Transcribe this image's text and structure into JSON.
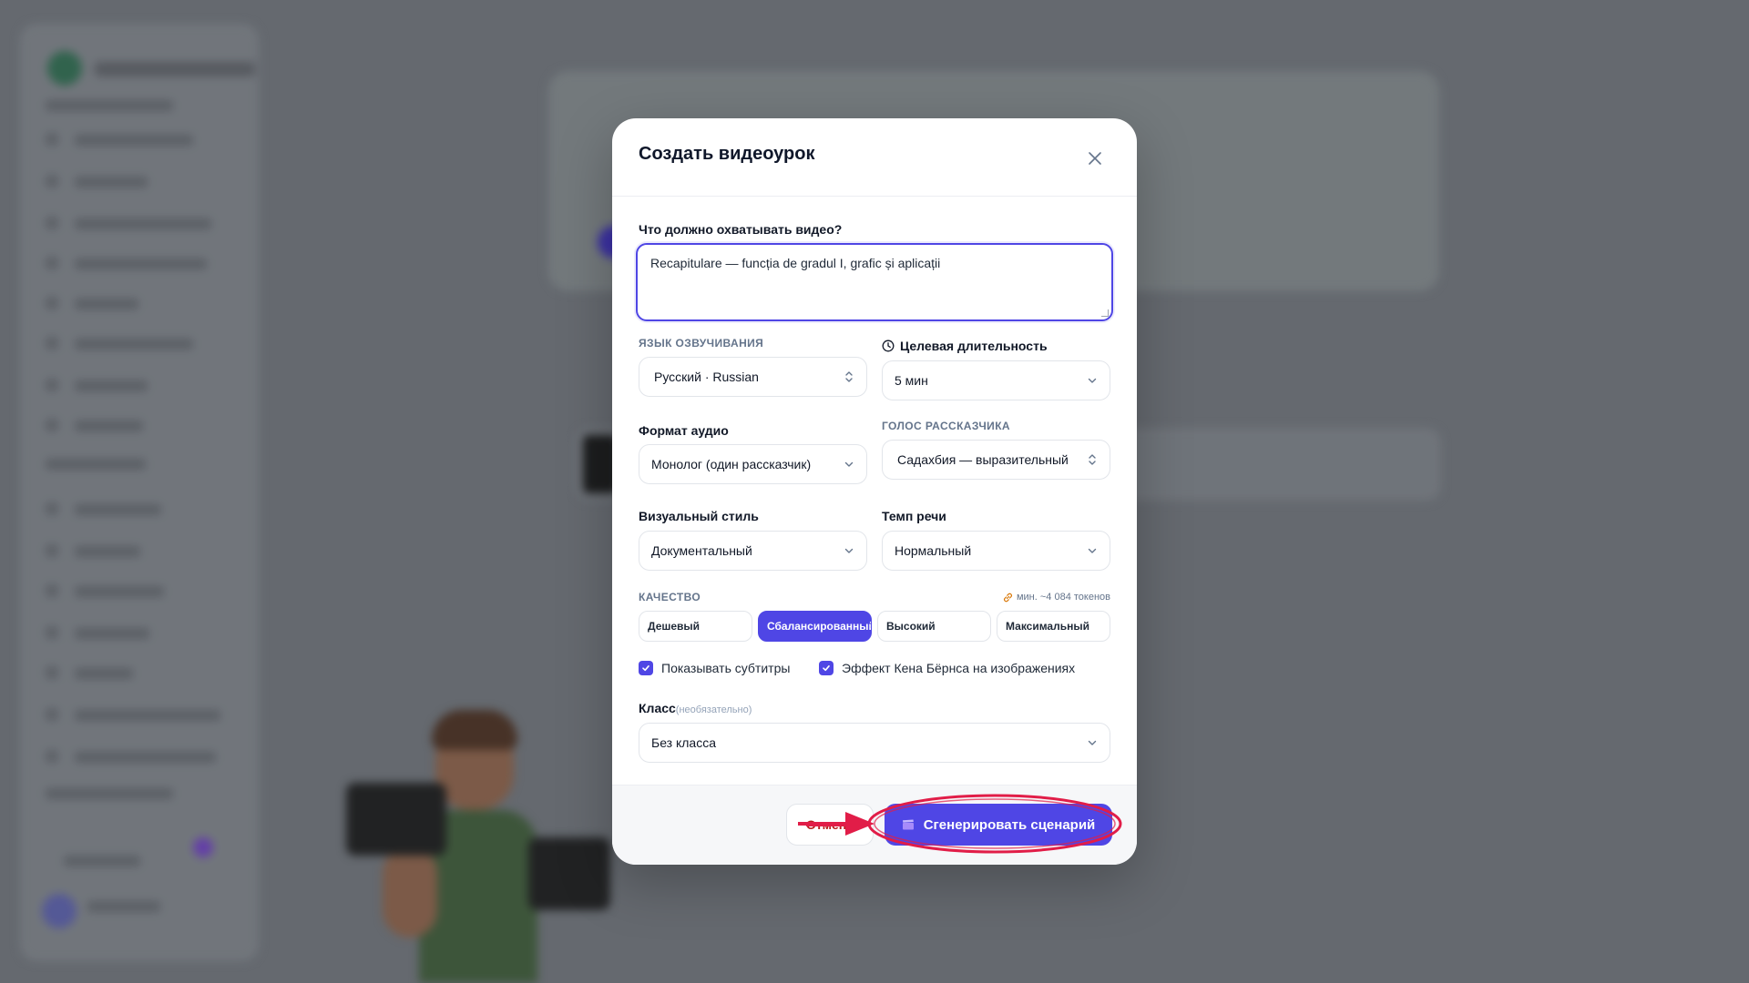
{
  "modal": {
    "title": "Создать видеоурок",
    "prompt": {
      "label": "Что должно охватывать видео?",
      "value": "Recapitulare — funcția de gradul I, grafic și aplicații"
    },
    "voice_language": {
      "label": "ЯЗЫК ОЗВУЧИВАНИЯ",
      "value": "Русский · Russian"
    },
    "target_duration": {
      "label": "Целевая длительность",
      "value": "5 мин"
    },
    "audio_format": {
      "label": "Формат аудио",
      "value": "Монолог (один рассказчик)"
    },
    "narrator_voice": {
      "label": "ГОЛОС РАССКАЗЧИКА",
      "value": "Садахбия — выразительный"
    },
    "visual_style": {
      "label": "Визуальный стиль",
      "value": "Документальный"
    },
    "speech_rate": {
      "label": "Темп речи",
      "value": "Нормальный"
    },
    "quality": {
      "label": "КАЧЕСТВО",
      "tokens_hint": "мин. ~4 084 токенов",
      "options": [
        "Дешевый",
        "Сбалансированный",
        "Высокий",
        "Максимальный"
      ],
      "selected": "Сбалансированный"
    },
    "subtitles": {
      "label": "Показывать субтитры",
      "checked": true
    },
    "ken_burns": {
      "label": "Эффект Кена Бёрнса на изображениях",
      "checked": true
    },
    "grade": {
      "label": "Класс",
      "optional": "(необязательно)",
      "value": "Без класса"
    },
    "footer": {
      "cancel_label": "Отмена",
      "generate_label": "Сгенерировать сценарий"
    }
  },
  "colors": {
    "accent": "#4f46e5",
    "annotation": "#e11d48",
    "backdrop": "#6e7278"
  },
  "icons": [
    "close-icon",
    "clock-icon",
    "chevron-down-icon",
    "updown-icon",
    "link-icon",
    "check-icon",
    "clapperboard-icon"
  ]
}
